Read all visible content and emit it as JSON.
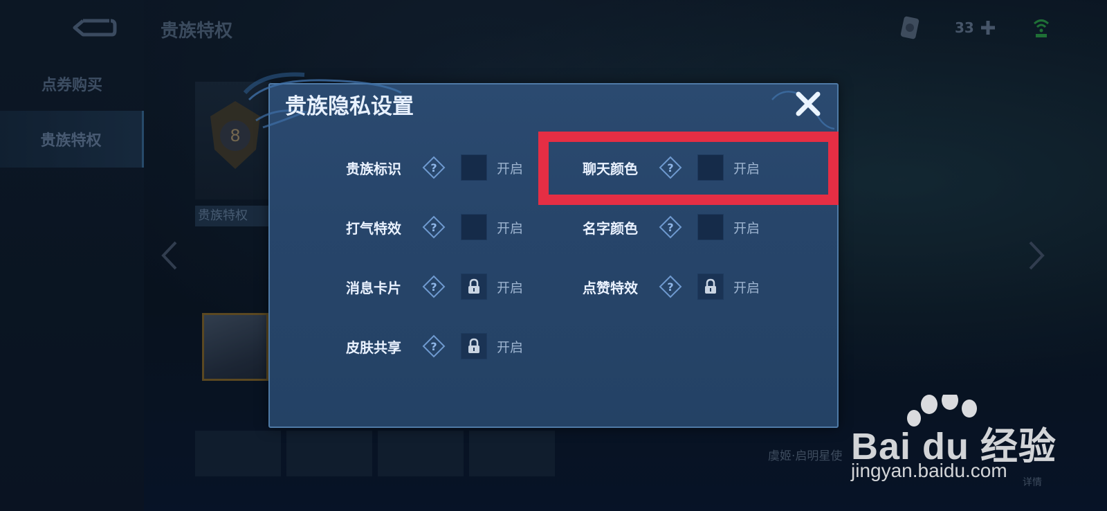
{
  "header": {
    "page_title": "贵族特权",
    "coupon_count": "33"
  },
  "sidebar": {
    "items": [
      {
        "label": "点券购买"
      },
      {
        "label": "贵族特权"
      }
    ]
  },
  "background": {
    "card_label": "贵族特权",
    "rank_number": "8",
    "skin_name": "虞姬·启明星使",
    "detail_text": "详情"
  },
  "modal": {
    "title": "贵族隐私设置",
    "settings": [
      {
        "label": "贵族标识",
        "toggle_text": "开启",
        "locked": false
      },
      {
        "label": "聊天颜色",
        "toggle_text": "开启",
        "locked": false
      },
      {
        "label": "打气特效",
        "toggle_text": "开启",
        "locked": false
      },
      {
        "label": "名字颜色",
        "toggle_text": "开启",
        "locked": false
      },
      {
        "label": "消息卡片",
        "toggle_text": "开启",
        "locked": true
      },
      {
        "label": "点赞特效",
        "toggle_text": "开启",
        "locked": true
      },
      {
        "label": "皮肤共享",
        "toggle_text": "开启",
        "locked": true
      }
    ]
  },
  "watermark": {
    "brand": "Bai du 经验",
    "url": "jingyan.baidu.com"
  },
  "colors": {
    "highlight": "#e52e44",
    "modal_bg": "#27456a",
    "modal_border": "#4f7aa6"
  }
}
